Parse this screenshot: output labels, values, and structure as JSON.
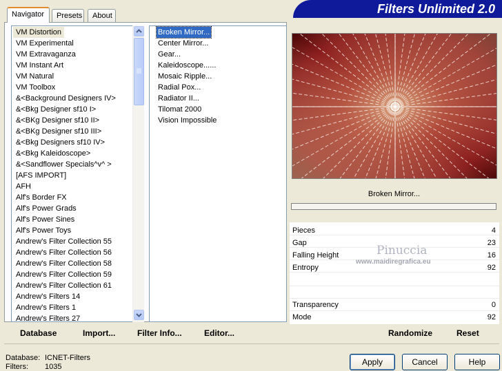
{
  "tabs": [
    "Navigator",
    "Presets",
    "About"
  ],
  "app_title": "Filters Unlimited 2.0",
  "categories": [
    "VM Distortion",
    "VM Experimental",
    "VM Extravaganza",
    "VM Instant Art",
    "VM Natural",
    "VM Toolbox",
    "&<Background Designers IV>",
    "&<Bkg Designer sf10 I>",
    "&<BKg Designer sf10 II>",
    "&<BKg Designer sf10 III>",
    "&<Bkg Designers sf10 IV>",
    "&<Bkg Kaleidoscope>",
    "&<Sandflower Specials^v^ >",
    "[AFS IMPORT]",
    "AFH",
    "Alf's Border FX",
    "Alf's Power Grads",
    "Alf's Power Sines",
    "Alf's Power Toys",
    "Andrew's Filter Collection 55",
    "Andrew's Filter Collection 56",
    "Andrew's Filter Collection 58",
    "Andrew's Filter Collection 59",
    "Andrew's Filter Collection 61",
    "Andrew's Filters 14",
    "Andrew's Filters 1",
    "Andrew's Filters 27"
  ],
  "selected_category": "VM Distortion",
  "filters": [
    "Broken Mirror...",
    "Center Mirror...",
    "Gear...",
    "Kaleidoscope......",
    "Mosaic Ripple...",
    "Radial Pox...",
    "Radiator II...",
    "Tilomat 2000",
    "Vision Impossible"
  ],
  "selected_filter": "Broken Mirror...",
  "current_filter_name": "Broken Mirror...",
  "progress": 0,
  "params": [
    {
      "label": "Pieces",
      "value": "4"
    },
    {
      "label": "Gap",
      "value": "23"
    },
    {
      "label": "Falling Height",
      "value": "16"
    },
    {
      "label": "Entropy",
      "value": "92"
    },
    {
      "label": "Transparency",
      "value": "0"
    },
    {
      "label": "Mode",
      "value": "92"
    }
  ],
  "watermark": {
    "name": "Pinuccia",
    "site": "www.maidiregrafica.eu"
  },
  "toolbar": {
    "database": "Database",
    "import": "Import...",
    "filter_info": "Filter Info...",
    "editor": "Editor...",
    "randomize": "Randomize",
    "reset": "Reset"
  },
  "status": {
    "database_label": "Database:",
    "database_value": "ICNET-Filters",
    "filters_label": "Filters:",
    "filters_value": "1035"
  },
  "buttons": {
    "apply": "Apply",
    "cancel": "Cancel",
    "help": "Help"
  },
  "icons": {
    "scroll_up": "chevron-up-icon",
    "scroll_down": "chevron-down-icon",
    "scroll_grip": "grip-icon"
  }
}
